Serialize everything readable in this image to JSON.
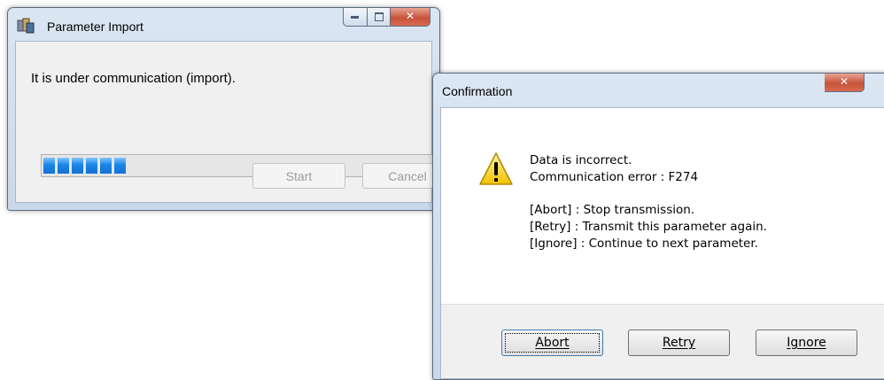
{
  "import_window": {
    "title": "Parameter Import",
    "message": "It is under communication (import).",
    "progress_segments": 6,
    "start_label": "Start",
    "cancel_label": "Cancel",
    "controls": {
      "minimize": "minimize-icon",
      "maximize": "maximize-icon",
      "close": "close-icon"
    }
  },
  "confirm_window": {
    "title": "Confirmation",
    "icon": "warning-icon",
    "line1": "Data is incorrect.",
    "line2": "Communication error : F274",
    "line3": "[Abort] : Stop transmission.",
    "line4": "[Retry] : Transmit this parameter again.",
    "line5": "[Ignore] : Continue to next parameter.",
    "buttons": {
      "abort": "Abort",
      "retry": "Retry",
      "ignore": "Ignore"
    }
  },
  "colors": {
    "progress": "#1b86e6",
    "close_button": "#c7543b",
    "title_bar": "#dbe6f3"
  }
}
